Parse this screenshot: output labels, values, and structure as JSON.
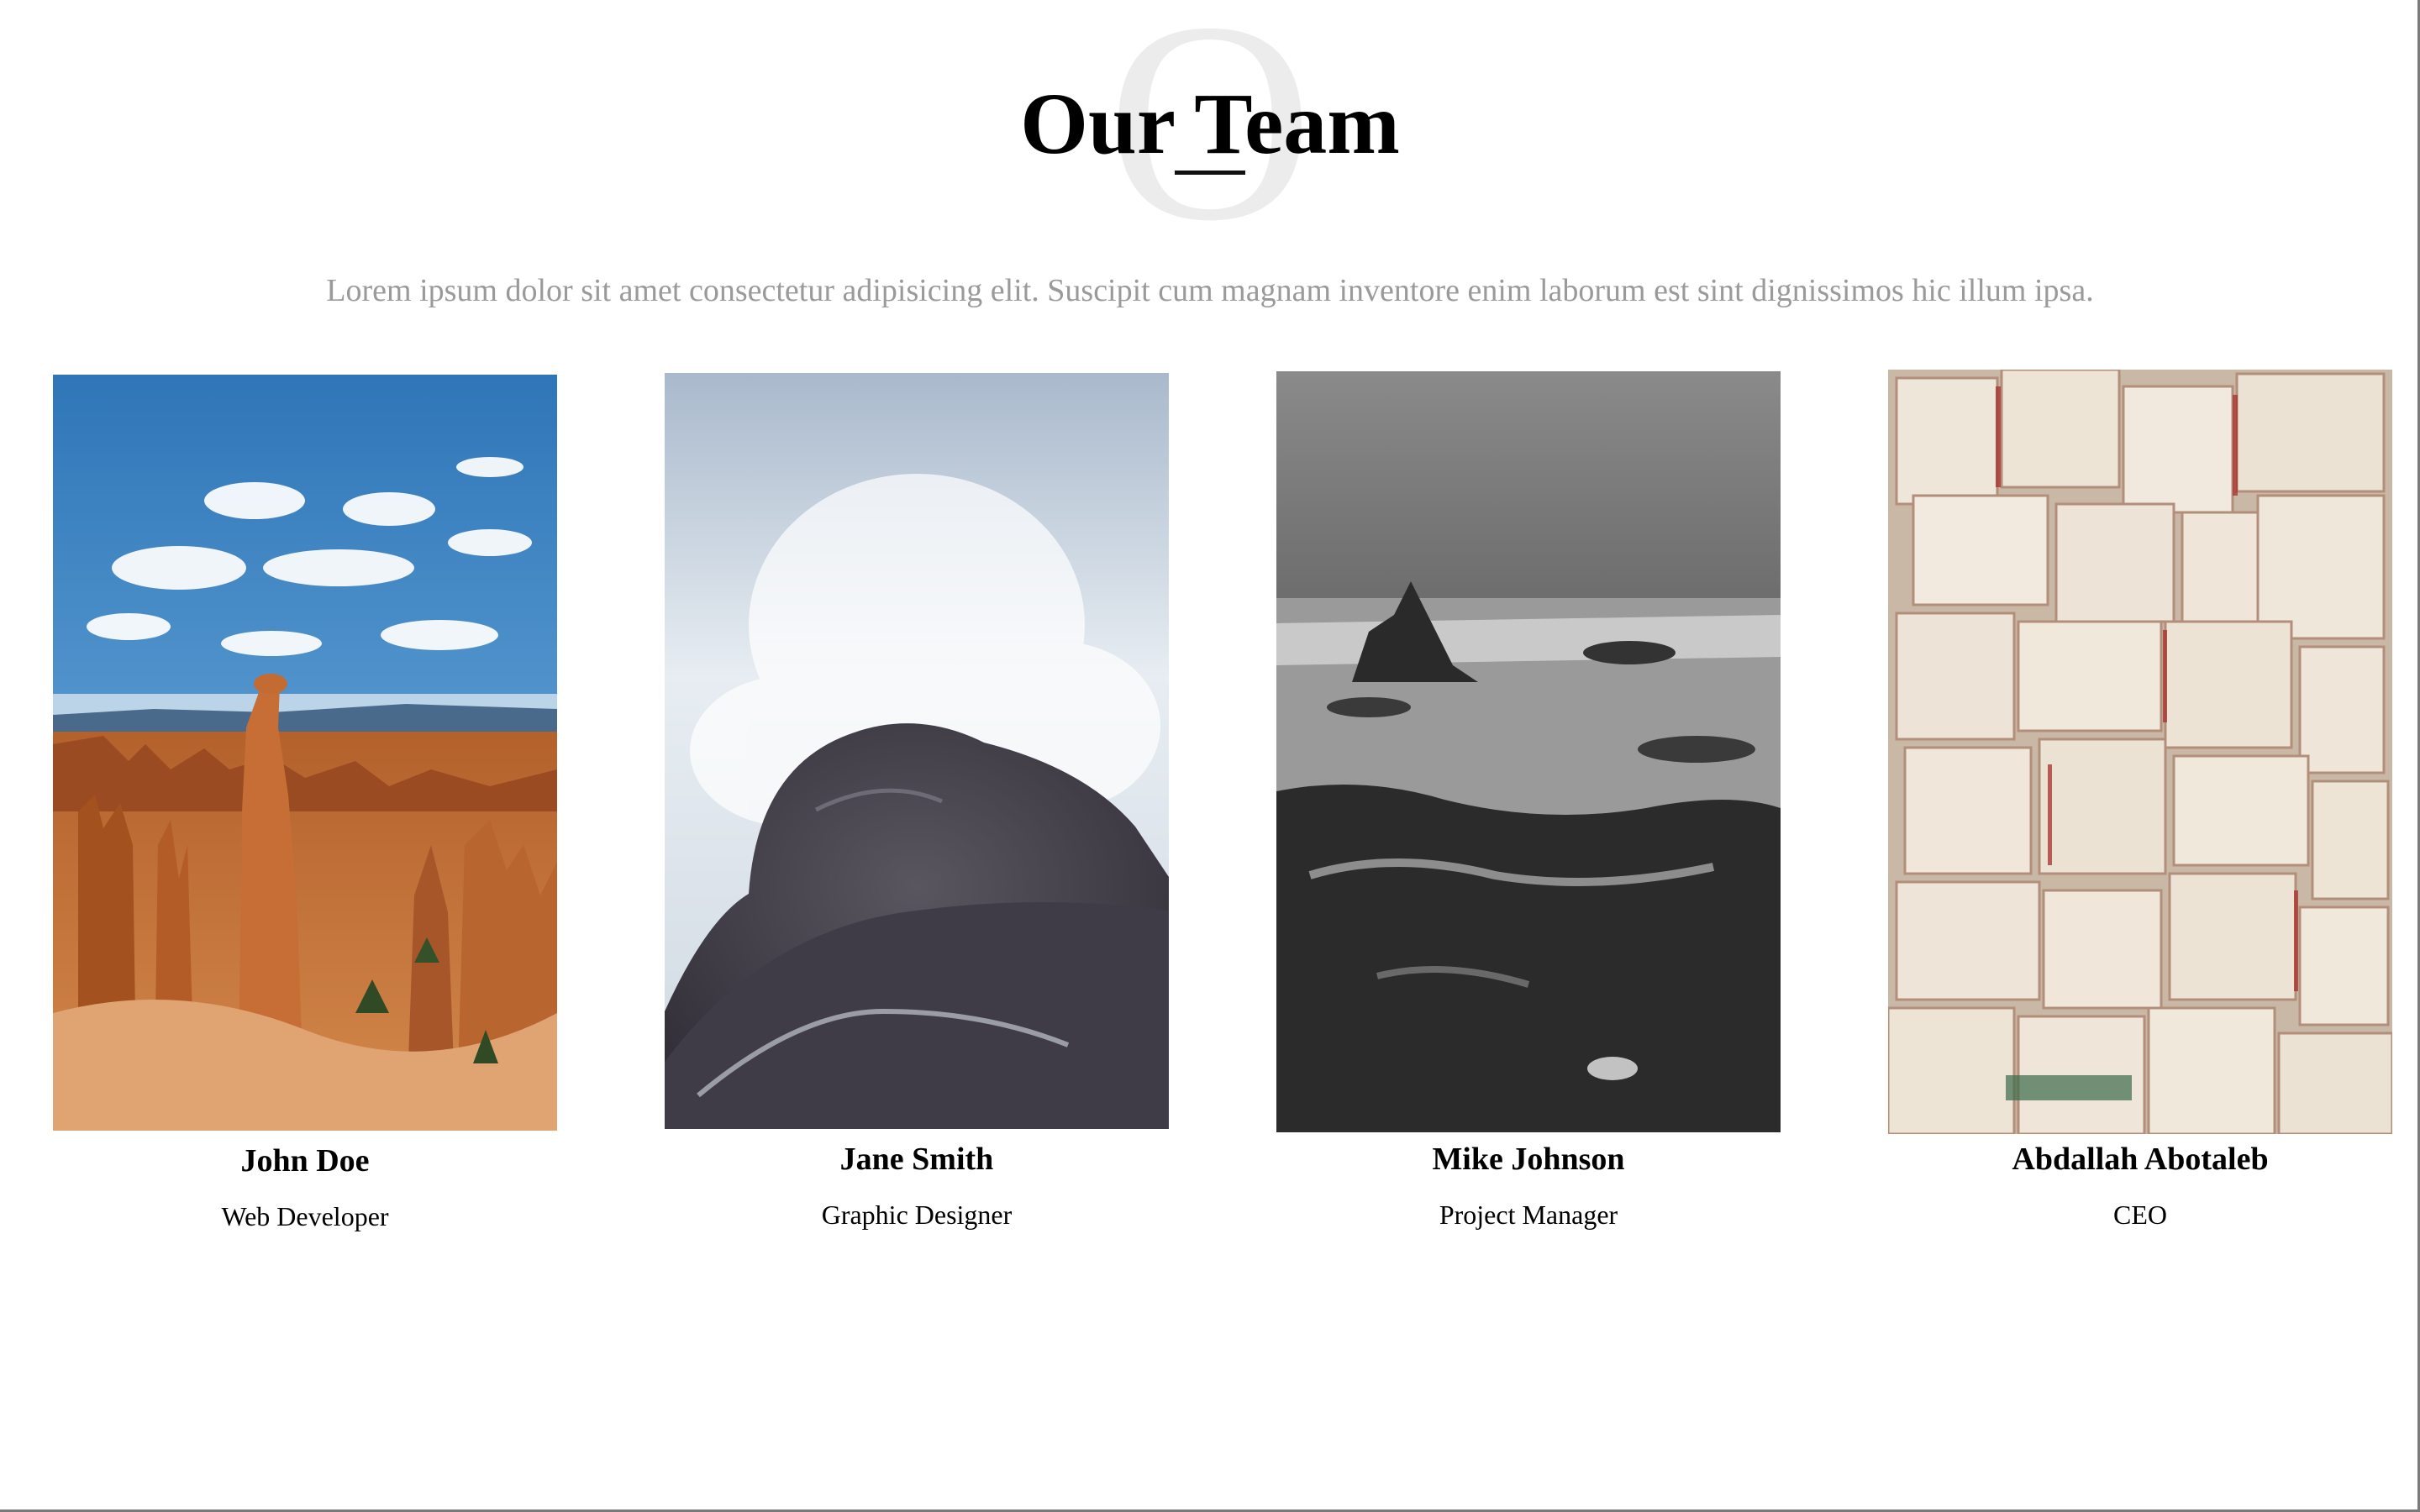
{
  "header": {
    "background_letter": "O",
    "title": "Our Team",
    "subtitle": "Lorem ipsum dolor sit amet consectetur adipisicing elit. Suscipit cum magnam inventore enim laborum est sint dignissimos hic illum ipsa."
  },
  "team": [
    {
      "name": "John Doe",
      "role": "Web Developer",
      "photo": "canyon-hoodoos-photo"
    },
    {
      "name": "Jane Smith",
      "role": "Graphic Designer",
      "photo": "ocean-wave-on-rock-photo"
    },
    {
      "name": "Mike Johnson",
      "role": "Project Manager",
      "photo": "rocky-coast-bw-photo"
    },
    {
      "name": "Abdallah Abotaleb",
      "role": "CEO",
      "photo": "open-books-wall-photo"
    }
  ],
  "colors": {
    "title": "#000000",
    "subtitle": "#9a9a9a",
    "background_letter": "#ececec"
  }
}
